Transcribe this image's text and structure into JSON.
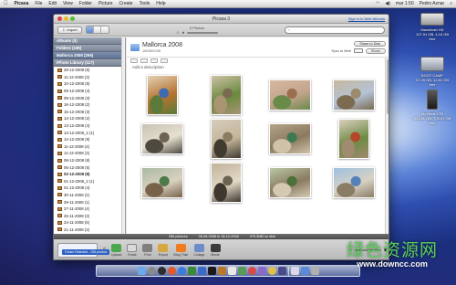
{
  "menubar": {
    "app": "Picasa",
    "items": [
      "File",
      "Edit",
      "View",
      "Folder",
      "Picture",
      "Create",
      "Tools",
      "Help"
    ],
    "clock": "mar 1:50",
    "user": "Pedro Aznar"
  },
  "desktop": [
    {
      "label": "Macintosh HD",
      "sub": "127.91 GB, 4.16 GB free"
    },
    {
      "label": "BOOT CAMP",
      "sub": "37.25 GB, 12.81 GB free"
    },
    {
      "label": "My Book 1TB",
      "sub": "931.51 GB, 703.01 GB free"
    }
  ],
  "window": {
    "title": "Picasa 3",
    "signin": "Sign in to Web Albums",
    "import": "Import",
    "photo_count": "0 Photos",
    "search_placeholder": ""
  },
  "sidebar": {
    "albums": "Albums (3)",
    "folders": "Folders (196)",
    "selected": "Mallorca 2008 (256)",
    "library": "iPhoto Library (117)",
    "items": [
      "29-12-2008 (5)",
      "11-12-2008 (3)",
      "10-12-2008 (5)",
      "09-12-2008 (4)",
      "09-12-2008 (3)",
      "16-12-2008 (2)",
      "15-12-2008 (3)",
      "14-12-2008 (2)",
      "13-12-2008 (4)",
      "13-12-2008_2 (1)",
      "12-12-2008 (9)",
      "11-12-2008 (4)",
      "11-12-2008 (3)",
      "08-12-2008 (8)",
      "05-12-2008 (5)",
      "02-12-2008 (8)",
      "01-12-2008_2 (1)",
      "01-12-2008 (4)",
      "30-11-2008 (2)",
      "29-11-2008 (1)",
      "27-11-2008 (4)",
      "26-11-2008 (3)",
      "24-11-2008 (6)",
      "21-11-2008 (2)",
      "21-11-2008_2 (3)",
      "19-11-2008 (2)",
      "17-11-2008 (5)"
    ],
    "bold_items": [
      "02-12-2008 (8)"
    ]
  },
  "album": {
    "title": "Mallorca 2008",
    "date": "18/08/2008",
    "share_btn": "Share to Disk",
    "sync_label": "Sync to Web",
    "sync_state": "Off",
    "share_label": "Share",
    "add_description": "Add a description"
  },
  "photos": [
    {
      "name": "blue-pot-on-wall",
      "palette": [
        "#e3d2b8",
        "#3c6bb4",
        "#b5732f",
        "#5b7a3a"
      ],
      "orient": "p"
    },
    {
      "name": "pot-plant-window",
      "palette": [
        "#cfc1a8",
        "#7b6a52",
        "#6a8a3e",
        "#a99474"
      ],
      "orient": "p"
    },
    {
      "name": "stone-doorway-pots",
      "palette": [
        "#d8b8a0",
        "#9b6e4f",
        "#c2a48d",
        "#6a8a4a"
      ],
      "orient": "l"
    },
    {
      "name": "village-street",
      "palette": [
        "#c6b89c",
        "#9c8a6c",
        "#b4c2d8",
        "#7b6b50"
      ],
      "orient": "l"
    },
    {
      "name": "people-street",
      "palette": [
        "#c8c2b2",
        "#6d6253",
        "#e6e0d0",
        "#4e4a40"
      ],
      "orient": "l"
    },
    {
      "name": "narrow-lane-walkers",
      "palette": [
        "#d6cdbb",
        "#8a7b63",
        "#c4b49a",
        "#403a30"
      ],
      "orient": "p"
    },
    {
      "name": "green-shutters",
      "palette": [
        "#b5a48a",
        "#3d7a52",
        "#8b7a60",
        "#cfc2a8"
      ],
      "orient": "l"
    },
    {
      "name": "flower-pot-wall",
      "palette": [
        "#d9cfbf",
        "#b4462a",
        "#6e8b43",
        "#a08a70"
      ],
      "orient": "p"
    },
    {
      "name": "green-door-plants",
      "palette": [
        "#aab8a4",
        "#4f7a4a",
        "#d9d2c0",
        "#78624a"
      ],
      "orient": "l"
    },
    {
      "name": "stone-stairs",
      "palette": [
        "#c0b39c",
        "#6e6250",
        "#e2d8c6",
        "#3f382e"
      ],
      "orient": "p"
    },
    {
      "name": "bicycle-plants",
      "palette": [
        "#b9c7a6",
        "#4d6f3a",
        "#8a7b60",
        "#d4cab4"
      ],
      "orient": "l"
    },
    {
      "name": "sea-view-rocks",
      "palette": [
        "#9cc0e0",
        "#5681b8",
        "#d8d2c4",
        "#8a7d66"
      ],
      "orient": "l"
    }
  ],
  "status": {
    "count": "256 pictures",
    "date": "06-08-2008 to 18-12-2008",
    "size": "475.3MB on disk"
  },
  "tray": {
    "held_label": "Folder Selected - 256 photos",
    "actions": [
      "Upload",
      "Email",
      "Print",
      "Export",
      "Blog This!",
      "Collage",
      "Movie"
    ]
  },
  "colors": {
    "accent": "#2e62c4",
    "selection": "#7d8fae"
  },
  "watermark": {
    "cn": "绿色资源网",
    "url": "www.downcc.com"
  }
}
